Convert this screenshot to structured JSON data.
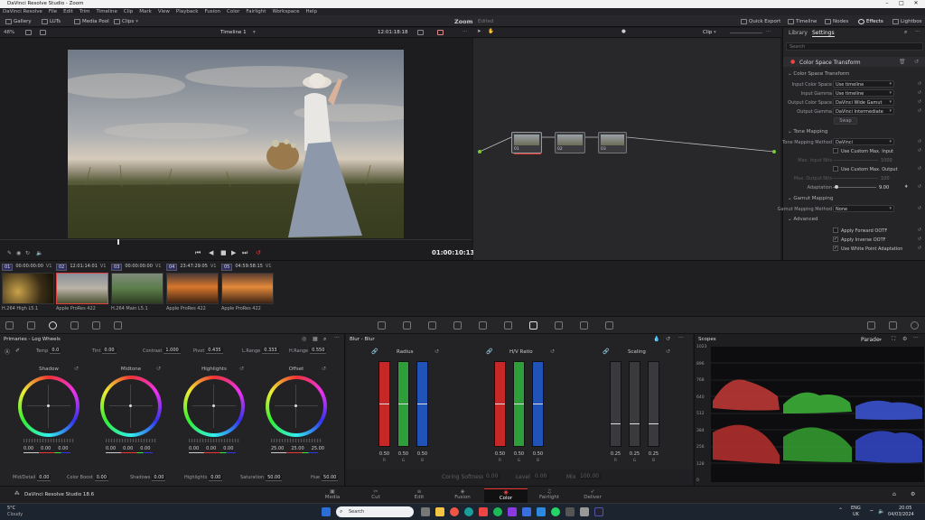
{
  "titlebar": {
    "title": "DaVinci Resolve Studio - Zoom"
  },
  "menu": [
    "DaVinci Resolve",
    "File",
    "Edit",
    "Trim",
    "Timeline",
    "Clip",
    "Mark",
    "View",
    "Playback",
    "Fusion",
    "Color",
    "Fairlight",
    "Workspace",
    "Help"
  ],
  "toolbar": {
    "gallery": "Gallery",
    "luts": "LUTs",
    "media_pool": "Media Pool",
    "clips": "Clips",
    "project": "Zoom",
    "status": "Edited",
    "quick_export": "Quick Export",
    "timeline": "Timeline",
    "nodes": "Nodes",
    "effects": "Effects",
    "lightbox": "Lightbox"
  },
  "viewer": {
    "zoom": "48%",
    "timeline_name": "Timeline 1",
    "timecode": "12:01:18:18",
    "clip_mode": "Clip",
    "end_timecode": "01:00:10:13"
  },
  "nodes": [
    {
      "label": "01"
    },
    {
      "label": "02"
    },
    {
      "label": "03"
    }
  ],
  "inspector": {
    "tab_library": "Library",
    "tab_settings": "Settings",
    "search_placeholder": "Search",
    "effect_title": "Color Space Transform",
    "section_cst": "Color Space Transform",
    "rows": [
      {
        "label": "Input Color Space",
        "value": "Use timeline"
      },
      {
        "label": "Input Gamma",
        "value": "Use timeline"
      },
      {
        "label": "Output Color Space",
        "value": "DaVinci Wide Gamut"
      },
      {
        "label": "Output Gamma",
        "value": "DaVinci Intermediate"
      }
    ],
    "swap": "Swap",
    "section_tone": "Tone Mapping",
    "tone_label": "Tone Mapping Method",
    "tone_value": "DaVinci",
    "custom_input": "Use Custom Max. Input",
    "max_input_label": "Max. Input Nits",
    "max_input_value": "1000",
    "custom_output": "Use Custom Max. Output",
    "max_output_label": "Max. Output Nits",
    "max_output_value": "100",
    "adaptation_label": "Adaptation",
    "adaptation_value": "9.00",
    "section_gamut": "Gamut Mapping",
    "gamut_label": "Gamut Mapping Method",
    "gamut_value": "None",
    "section_advanced": "Advanced",
    "adv": [
      {
        "label": "Apply Forward OOTF",
        "checked": ""
      },
      {
        "label": "Apply Inverse OOTF",
        "checked": "✓"
      },
      {
        "label": "Use White Point Adaptation",
        "checked": "✓"
      }
    ]
  },
  "clips": [
    {
      "num": "01",
      "tc": "00:00:00:00",
      "track": "V1",
      "name": "H.264 High L5.1"
    },
    {
      "num": "02",
      "tc": "12:01:14:01",
      "track": "V1",
      "name": "Apple ProRes 422"
    },
    {
      "num": "03",
      "tc": "00:00:00:00",
      "track": "V1",
      "name": "H.264 Main L5.1"
    },
    {
      "num": "04",
      "tc": "23:47:29:05",
      "track": "V1",
      "name": "Apple ProRes 422"
    },
    {
      "num": "05",
      "tc": "04:59:58:15",
      "track": "V1",
      "name": "Apple ProRes 422"
    }
  ],
  "primaries": {
    "title": "Primaries - Log Wheels",
    "params": [
      {
        "label": "Temp",
        "value": "0.0"
      },
      {
        "label": "Tint",
        "value": "0.00"
      },
      {
        "label": "Contrast",
        "value": "1.000"
      },
      {
        "label": "Pivot",
        "value": "0.435"
      },
      {
        "label": "L.Range",
        "value": "0.333"
      },
      {
        "label": "H.Range",
        "value": "0.550"
      }
    ],
    "wheels": [
      {
        "name": "Shadow",
        "vals": [
          "0.00",
          "0.00",
          "0.00"
        ]
      },
      {
        "name": "Midtone",
        "vals": [
          "0.00",
          "0.00",
          "0.00"
        ]
      },
      {
        "name": "Highlights",
        "vals": [
          "0.00",
          "0.00",
          "0.00"
        ]
      },
      {
        "name": "Offset",
        "vals": [
          "25.00",
          "25.00",
          "25.00"
        ]
      }
    ],
    "bottom": [
      {
        "label": "Mid/Detail",
        "value": "0.00"
      },
      {
        "label": "Color Boost",
        "value": "0.00"
      },
      {
        "label": "Shadows",
        "value": "0.00"
      },
      {
        "label": "Highlights",
        "value": "0.00"
      },
      {
        "label": "Saturation",
        "value": "50.00"
      },
      {
        "label": "Hue",
        "value": "50.00"
      }
    ]
  },
  "blur": {
    "title": "Blur - Blur",
    "radius": "Radius",
    "hv": "H/V Ratio",
    "scaling": "Scaling",
    "radius_vals": [
      "0.50",
      "0.50",
      "0.50"
    ],
    "hv_vals": [
      "0.50",
      "0.50",
      "0.50"
    ],
    "scaling_vals": [
      "0.25",
      "0.25",
      "0.25"
    ],
    "channels": [
      "R",
      "G",
      "B"
    ],
    "coring_label": "Coring Softness",
    "coring_value": "0.00",
    "level_label": "Level",
    "level_value": "0.00",
    "mix_label": "Mix",
    "mix_value": "100.00"
  },
  "scopes": {
    "title": "Scopes",
    "mode": "Parade",
    "ticks": [
      "1023",
      "896",
      "768",
      "640",
      "512",
      "384",
      "256",
      "128",
      "0"
    ]
  },
  "app_footer": "DaVinci Resolve Studio 18.6",
  "pages": [
    "Media",
    "Cut",
    "Edit",
    "Fusion",
    "Color",
    "Fairlight",
    "Deliver"
  ],
  "taskbar": {
    "weather_temp": "5°C",
    "weather_desc": "Cloudy",
    "search": "Search",
    "lang": "ENG",
    "region": "UK",
    "time": "20:05",
    "date": "04/03/2024"
  }
}
